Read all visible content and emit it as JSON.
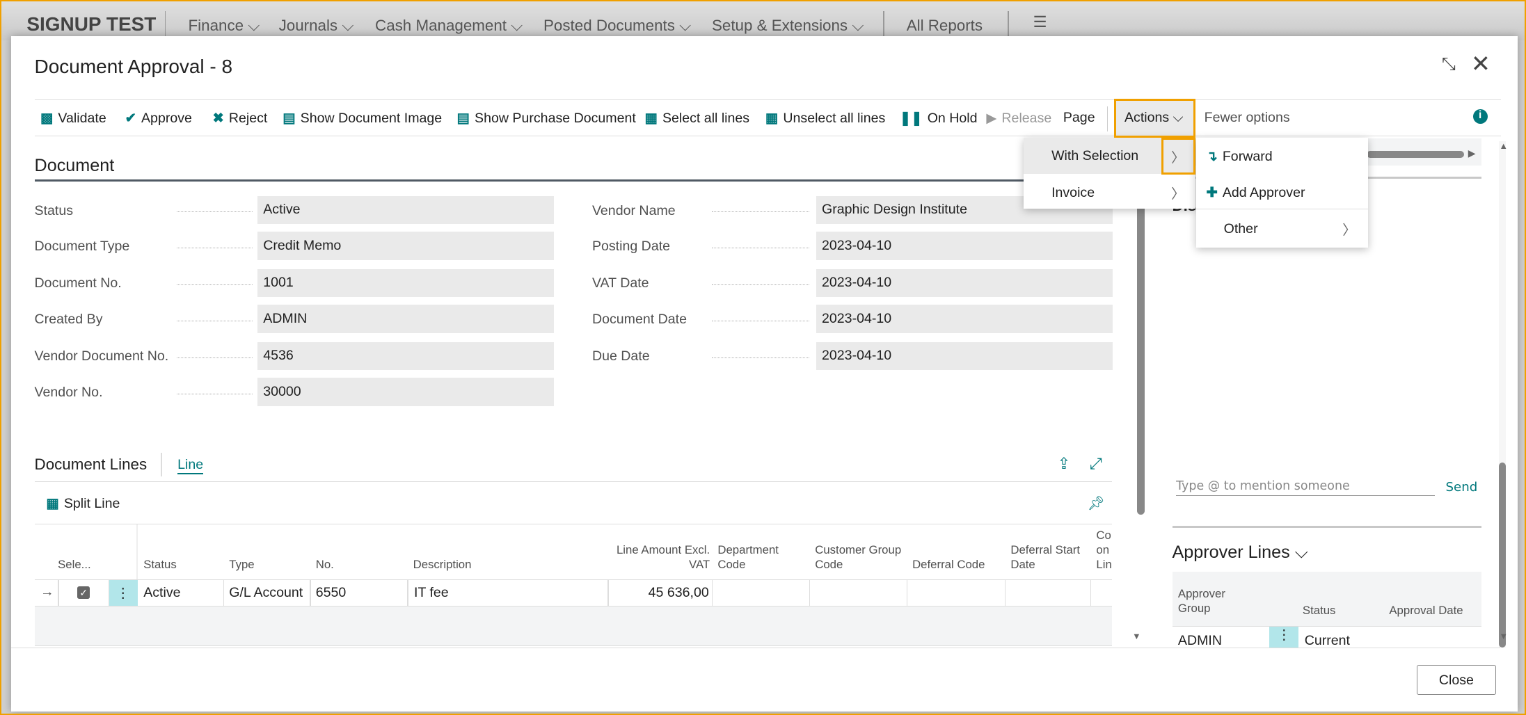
{
  "app": {
    "company": "SIGNUP TEST",
    "nav": [
      "Finance",
      "Journals",
      "Cash Management",
      "Posted Documents",
      "Setup & Extensions",
      "All Reports"
    ]
  },
  "dialog": {
    "title": "Document Approval - 8",
    "close_label": "Close"
  },
  "toolbar": {
    "validate": "Validate",
    "approve": "Approve",
    "reject": "Reject",
    "show_image": "Show Document Image",
    "show_purchase": "Show Purchase Document",
    "select_all": "Select all lines",
    "unselect_all": "Unselect all lines",
    "on_hold": "On Hold",
    "release": "Release",
    "page": "Page",
    "actions": "Actions",
    "fewer": "Fewer options"
  },
  "actions_menu": {
    "items": [
      "With Selection",
      "Invoice"
    ],
    "submenu": [
      "Forward",
      "Add Approver",
      "Other"
    ]
  },
  "document": {
    "heading": "Document",
    "left": [
      {
        "label": "Status",
        "value": "Active"
      },
      {
        "label": "Document Type",
        "value": "Credit Memo"
      },
      {
        "label": "Document No.",
        "value": "1001"
      },
      {
        "label": "Created By",
        "value": "ADMIN"
      },
      {
        "label": "Vendor Document No.",
        "value": "4536"
      },
      {
        "label": "Vendor No.",
        "value": "30000"
      }
    ],
    "right": [
      {
        "label": "Vendor Name",
        "value": "Graphic Design Institute"
      },
      {
        "label": "Posting Date",
        "value": "2023-04-10"
      },
      {
        "label": "VAT Date",
        "value": "2023-04-10"
      },
      {
        "label": "Document Date",
        "value": "2023-04-10"
      },
      {
        "label": "Due Date",
        "value": "2023-04-10"
      }
    ]
  },
  "lines": {
    "heading": "Document Lines",
    "tab": "Line",
    "split": "Split Line",
    "columns": [
      "Sele...",
      "Status",
      "Type",
      "No.",
      "Description",
      "Line Amount Excl. VAT",
      "Department Code",
      "Customer Group Code",
      "Deferral Code",
      "Deferral Start Date",
      "Co on Lin"
    ],
    "rows": [
      {
        "selected": true,
        "status": "Active",
        "type": "G/L Account",
        "no": "6550",
        "description": "IT fee",
        "amount": "45 636,00"
      }
    ]
  },
  "side": {
    "partial_heading": "Dis",
    "comment_placeholder": "Type @ to mention someone",
    "send": "Send",
    "approver_heading": "Approver Lines",
    "approver_columns": [
      "Approver Group",
      "Status",
      "Approval Date"
    ],
    "approver_rows": [
      {
        "group": "ADMIN",
        "status": "Current"
      }
    ]
  }
}
